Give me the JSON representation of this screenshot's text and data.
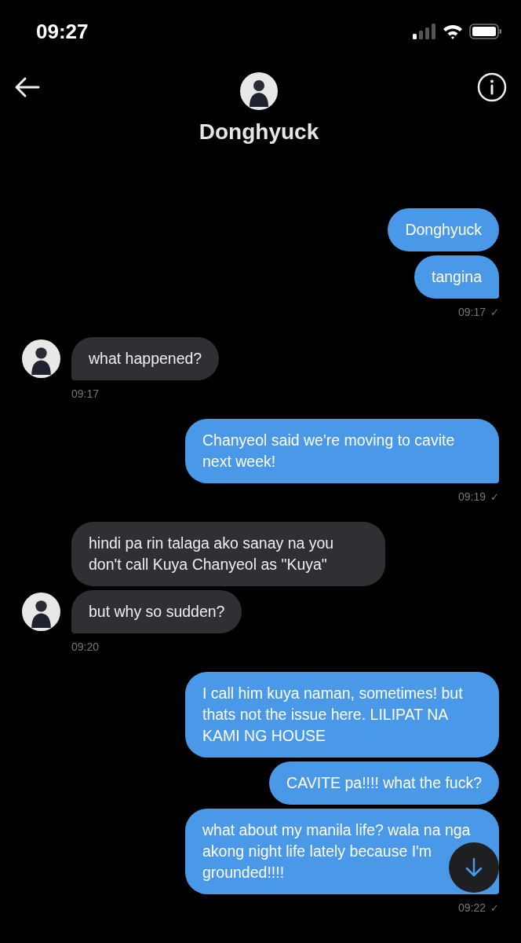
{
  "status_bar": {
    "time": "09:27"
  },
  "header": {
    "title": "Donghyuck"
  },
  "groups": [
    {
      "kind": "me",
      "messages": [
        "Donghyuck",
        "tangina"
      ],
      "time": "09:17",
      "receipt": "✓"
    },
    {
      "kind": "them",
      "messages": [
        "what happened?"
      ],
      "time": "09:17"
    },
    {
      "kind": "me",
      "messages": [
        "Chanyeol said we're moving to cavite next week!"
      ],
      "time": "09:19",
      "receipt": "✓"
    },
    {
      "kind": "them",
      "messages": [
        "hindi pa rin talaga ako sanay na you don't call Kuya Chanyeol as \"Kuya\"",
        "but why so sudden?"
      ],
      "time": "09:20"
    },
    {
      "kind": "me",
      "messages": [
        "I call him kuya naman, sometimes! but thats not the issue here. LILIPAT NA KAMI NG HOUSE",
        "CAVITE pa!!!! what the fuck?",
        "what about my manila life? wala na nga akong night life lately because I'm grounded!!!!"
      ],
      "time": "09:22",
      "receipt": "✓"
    }
  ]
}
